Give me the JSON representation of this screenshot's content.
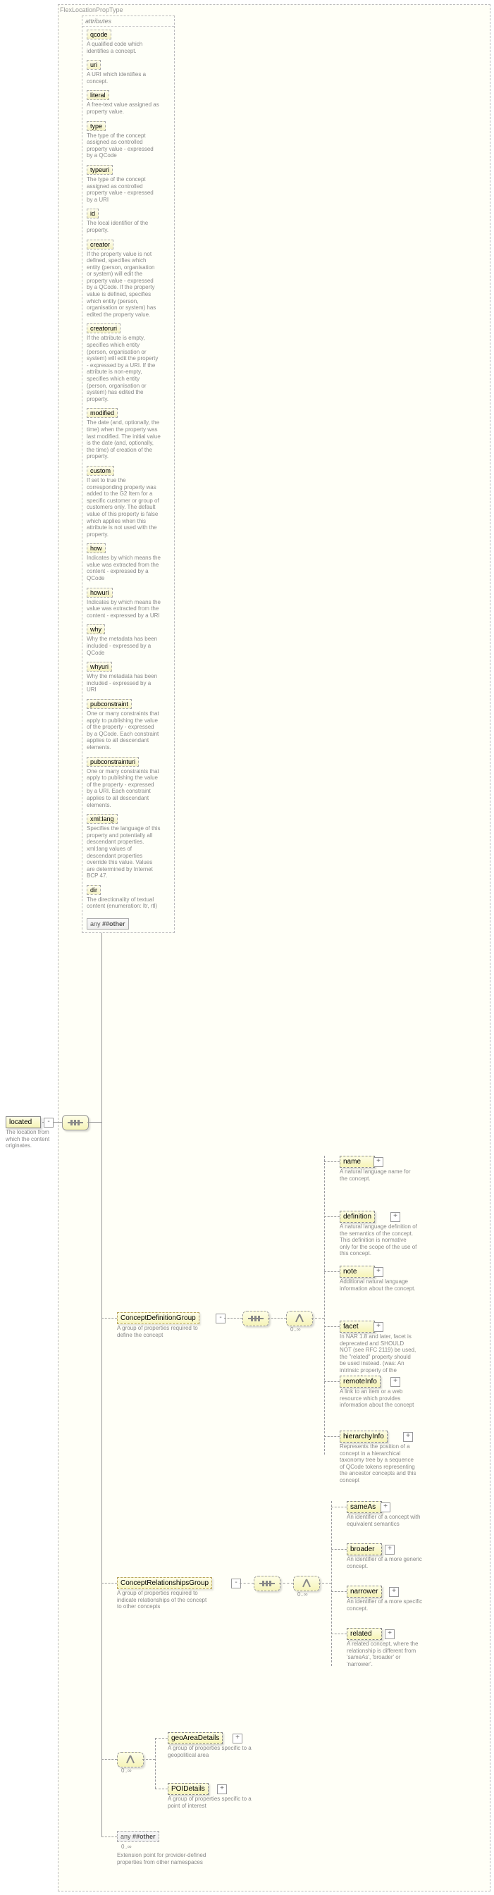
{
  "type": {
    "name": "FlexLocationPropType"
  },
  "root": {
    "name": "located",
    "desc": "The location from which the content originates."
  },
  "attrs_header": "attributes",
  "attrs": [
    {
      "name": "qcode",
      "desc": "A qualified code which identifies a concept."
    },
    {
      "name": "uri",
      "desc": "A URI which identifies a concept."
    },
    {
      "name": "literal",
      "desc": "A free-text value assigned as property value."
    },
    {
      "name": "type",
      "desc": "The type of the concept assigned as controlled property value - expressed by a QCode"
    },
    {
      "name": "typeuri",
      "desc": "The type of the concept assigned as controlled property value - expressed by a URI"
    },
    {
      "name": "id",
      "desc": "The local identifier of the property."
    },
    {
      "name": "creator",
      "desc": "If the property value is not defined, specifies which entity (person, organisation or system) will edit the property value - expressed by a QCode. If the property value is defined, specifies which entity (person, organisation or system) has edited the property value."
    },
    {
      "name": "creatoruri",
      "desc": "If the attribute is empty, specifies which entity (person, organisation or system) will edit the property - expressed by a URI. If the attribute is non-empty, specifies which entity (person, organisation or system) has edited the property."
    },
    {
      "name": "modified",
      "desc": "The date (and, optionally, the time) when the property was last modified. The initial value is the date (and, optionally, the time) of creation of the property."
    },
    {
      "name": "custom",
      "desc": "If set to true the corresponding property was added to the G2 Item for a specific customer or group of customers only. The default value of this property is false which applies when this attribute is not used with the property."
    },
    {
      "name": "how",
      "desc": "Indicates by which means the value was extracted from the content - expressed by a QCode"
    },
    {
      "name": "howuri",
      "desc": "Indicates by which means the value was extracted from the content - expressed by a URI"
    },
    {
      "name": "why",
      "desc": "Why the metadata has been included - expressed by a QCode"
    },
    {
      "name": "whyuri",
      "desc": "Why the metadata has been included - expressed by a URI"
    },
    {
      "name": "pubconstraint",
      "desc": "One or many constraints that apply to publishing the value of the property - expressed by a QCode. Each constraint applies to all descendant elements."
    },
    {
      "name": "pubconstrainturi",
      "desc": "One or many constraints that apply to publishing the value of the property - expressed by a URI. Each constraint applies to all descendant elements."
    },
    {
      "name": "xml:lang",
      "desc": "Specifies the language of this property and potentially all descendant properties. xml:lang values of descendant properties override this value. Values are determined by Internet BCP 47."
    },
    {
      "name": "dir",
      "desc": "The directionality of textual content (enumeration: ltr, rtl)"
    }
  ],
  "any_attr": "##other",
  "any_label": "any",
  "groups": {
    "def": {
      "name": "ConceptDefinitionGroup",
      "desc": "A group of properties required to define the concept"
    },
    "rel": {
      "name": "ConceptRelationshipsGroup",
      "desc": "A group of properties required to indicate relationships of the concept to other concepts"
    },
    "geo": {
      "name": "geoAreaDetails",
      "desc": "A group of properties specific to a geopolitical area"
    },
    "poi": {
      "name": "POIDetails",
      "desc": "A group of properties specific to a point of interest"
    },
    "any_elem": {
      "label": "##other",
      "desc": "Extension point for provider-defined properties from other namespaces"
    }
  },
  "def_children": [
    {
      "name": "name",
      "desc": "A natural language name for the concept."
    },
    {
      "name": "definition",
      "desc": "A natural language definition of the semantics of the concept. This definition is normative only for the scope of the use of this concept."
    },
    {
      "name": "note",
      "desc": "Additional natural language information about the concept."
    },
    {
      "name": "facet",
      "desc": "In NAR 1.8 and later, facet is deprecated and SHOULD NOT (see RFC 2119) be used, the \"related\" property should be used instead. (was: An intrinsic property of the concept.)"
    },
    {
      "name": "remoteInfo",
      "desc": "A link to an item or a web resource which provides information about the concept"
    },
    {
      "name": "hierarchyInfo",
      "desc": "Represents the position of a concept in a hierarchical taxonomy tree by a sequence of QCode tokens representing the ancestor concepts and this concept"
    }
  ],
  "rel_children": [
    {
      "name": "sameAs",
      "desc": "An identifier of a concept with equivalent semantics"
    },
    {
      "name": "broader",
      "desc": "An identifier of a more generic concept."
    },
    {
      "name": "narrower",
      "desc": "An identifier of a more specific concept."
    },
    {
      "name": "related",
      "desc": "A related concept, where the relationship is different from 'sameAs', 'broader' or 'narrower'."
    }
  ],
  "occ": "0..∞"
}
